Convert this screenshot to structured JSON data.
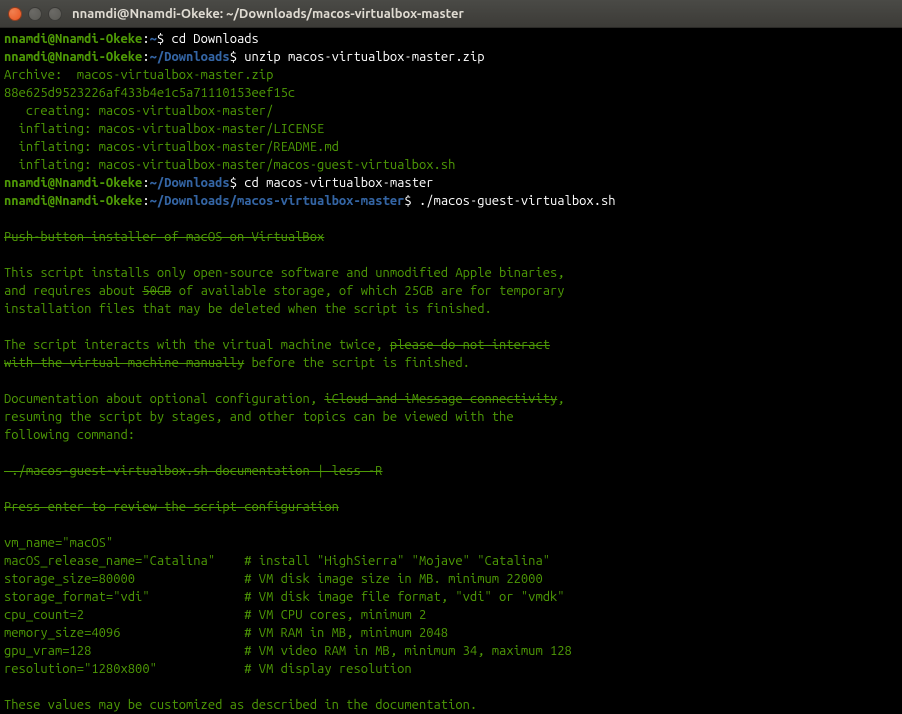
{
  "window": {
    "title": "nnamdi@Nnamdi-Okeke: ~/Downloads/macos-virtualbox-master"
  },
  "prompts": {
    "user_host": "nnamdi@Nnamdi-Okeke",
    "path1": "~",
    "path2": "~/Downloads",
    "path3": "~/Downloads/macos-virtualbox-master",
    "colon": ":",
    "dollar": "$ "
  },
  "commands": {
    "cd_downloads": "cd Downloads",
    "unzip": "unzip macos-virtualbox-master.zip",
    "cd_master": "cd macos-virtualbox-master",
    "run_script": "./macos-guest-virtualbox.sh"
  },
  "unzip_output": {
    "archive": "Archive:  macos-virtualbox-master.zip",
    "hash": "88e625d9523226af433b4e1c5a71110153eef15c",
    "creating": "   creating: macos-virtualbox-master/",
    "inflating1": "  inflating: macos-virtualbox-master/LICENSE",
    "inflating2": "  inflating: macos-virtualbox-master/README.md",
    "inflating3": "  inflating: macos-virtualbox-master/macos-guest-virtualbox.sh"
  },
  "script": {
    "title": "Push-button installer of macOS on VirtualBox",
    "desc1a": "This script installs only open-source software and unmodified Apple binaries,",
    "desc1b_pre": "and requires about ",
    "desc1b_strike": "50GB",
    "desc1b_post": " of available storage, of which 25GB are for temporary",
    "desc1c": "installation files that may be deleted when the script is finished.",
    "desc2a_pre": "The script interacts with the virtual machine twice, ",
    "desc2a_strike": "please do not interact",
    "desc2b_strike": "with the virtual machine manually",
    "desc2b_post": " before the script is finished.",
    "desc3a_pre": "Documentation about optional configuration, ",
    "desc3a_strike": "iCloud and iMessage connectivity",
    "desc3a_post": ",",
    "desc3b": "resuming the script by stages, and other topics can be viewed with the",
    "desc3c": "following command:",
    "doc_cmd": " ./macos-guest-virtualbox.sh documentation | less -R",
    "press_enter": "Press enter to review the script configuration",
    "config": {
      "vm_name": "vm_name=\"macOS\"",
      "release_name": "macOS_release_name=\"Catalina\"    # install \"HighSierra\" \"Mojave\" \"Catalina\"",
      "storage_size": "storage_size=80000               # VM disk image size in MB. minimum 22000",
      "storage_format": "storage_format=\"vdi\"             # VM disk image file format, \"vdi\" or \"vmdk\"",
      "cpu_count": "cpu_count=2                      # VM CPU cores, minimum 2",
      "memory_size": "memory_size=4096                 # VM RAM in MB, minimum 2048",
      "gpu_vram": "gpu_vram=128                     # VM video RAM in MB, minimum 34, maximum 128",
      "resolution": "resolution=\"1280x800\"            # VM display resolution"
    },
    "footer": "These values may be customized as described in the documentation."
  }
}
